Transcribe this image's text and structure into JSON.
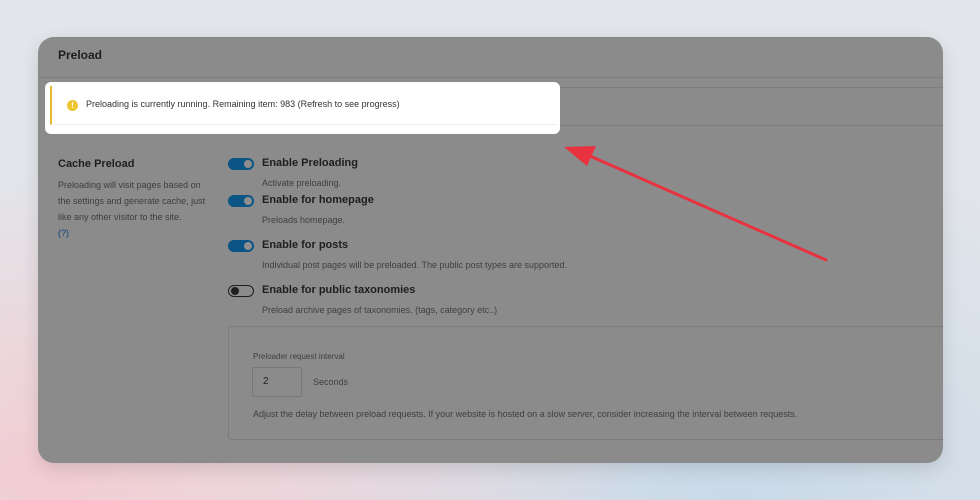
{
  "panel": {
    "title": "Preload"
  },
  "notice": {
    "icon": "warning-icon",
    "icon_glyph": "!",
    "text": "Preloading is currently running. Remaining item: 983 (Refresh to see progress)"
  },
  "section": {
    "title": "Cache Preload",
    "description": "Preloading will visit pages based on the settings and generate cache, just like any other visitor to the site.",
    "help_link": "(?)"
  },
  "options": [
    {
      "label": "Enable Preloading",
      "description": "Activate preloading.",
      "enabled": true
    },
    {
      "label": "Enable for homepage",
      "description": "Preloads homepage.",
      "enabled": true
    },
    {
      "label": "Enable for posts",
      "description": "Individual post pages will be preloaded. The public post types are supported.",
      "enabled": true
    },
    {
      "label": "Enable for public taxonomies",
      "description": "Preload archive pages of taxonomies. (tags, category etc..)",
      "enabled": false
    }
  ],
  "interval": {
    "label": "Preloader request interval",
    "value": "2",
    "unit": "Seconds",
    "description": "Adjust the delay between preload requests. If your website is hosted on a slow server, consider increasing the interval between requests."
  },
  "colors": {
    "toggle_on": "#0b5486",
    "warning": "#eec52f",
    "arrow": "#e8323f"
  }
}
